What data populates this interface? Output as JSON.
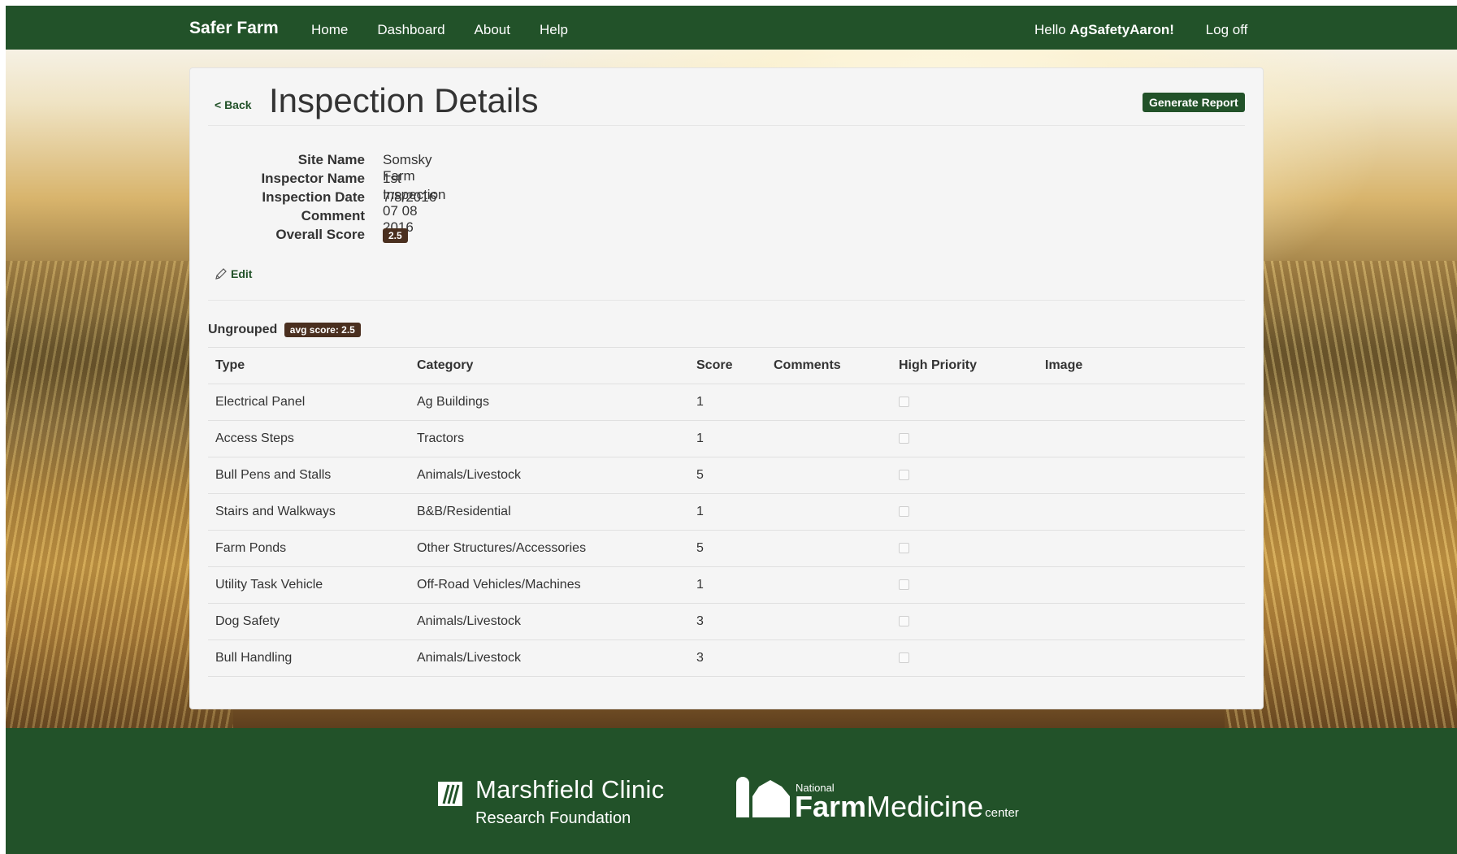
{
  "nav": {
    "brand": "Safer Farm",
    "links": [
      "Home",
      "Dashboard",
      "About",
      "Help"
    ],
    "greeting_prefix": "Hello ",
    "username": "AgSafetyAaron!",
    "logoff": "Log off"
  },
  "header": {
    "back": "< Back",
    "title": "Inspection Details",
    "generate_report": "Generate Report"
  },
  "details": {
    "site_name_label": "Site Name",
    "site_name": "Somsky Farm",
    "inspector_name_label": "Inspector Name",
    "inspector_name": "1st Inspection 07 08 2016",
    "inspection_date_label": "Inspection Date",
    "inspection_date": "7/8/2016",
    "comment_label": "Comment",
    "comment": "",
    "overall_score_label": "Overall Score",
    "overall_score": "2.5"
  },
  "edit_label": "Edit",
  "group": {
    "name": "Ungrouped",
    "avg_score": "avg score: 2.5"
  },
  "table": {
    "headers": [
      "Type",
      "Category",
      "Score",
      "Comments",
      "High Priority",
      "Image"
    ],
    "rows": [
      {
        "type": "Electrical Panel",
        "category": "Ag Buildings",
        "score": "1",
        "comments": "",
        "high_priority": false
      },
      {
        "type": "Access Steps",
        "category": "Tractors",
        "score": "1",
        "comments": "",
        "high_priority": false
      },
      {
        "type": "Bull Pens and Stalls",
        "category": "Animals/Livestock",
        "score": "5",
        "comments": "",
        "high_priority": false
      },
      {
        "type": "Stairs and Walkways",
        "category": "B&B/Residential",
        "score": "1",
        "comments": "",
        "high_priority": false
      },
      {
        "type": "Farm Ponds",
        "category": "Other Structures/Accessories",
        "score": "5",
        "comments": "",
        "high_priority": false
      },
      {
        "type": "Utility Task Vehicle",
        "category": "Off-Road Vehicles/Machines",
        "score": "1",
        "comments": "",
        "high_priority": false
      },
      {
        "type": "Dog Safety",
        "category": "Animals/Livestock",
        "score": "3",
        "comments": "",
        "high_priority": false
      },
      {
        "type": "Bull Handling",
        "category": "Animals/Livestock",
        "score": "3",
        "comments": "",
        "high_priority": false
      }
    ]
  },
  "footer": {
    "logo1_line1": "Marshfield Clinic",
    "logo1_line2": "Research Foundation",
    "logo2_small": "National",
    "logo2_bold": "Farm",
    "logo2_rest": "Medicine",
    "logo2_tag": "center"
  },
  "colors": {
    "brand_green": "#225229",
    "badge_brown": "#4a2f1f"
  }
}
